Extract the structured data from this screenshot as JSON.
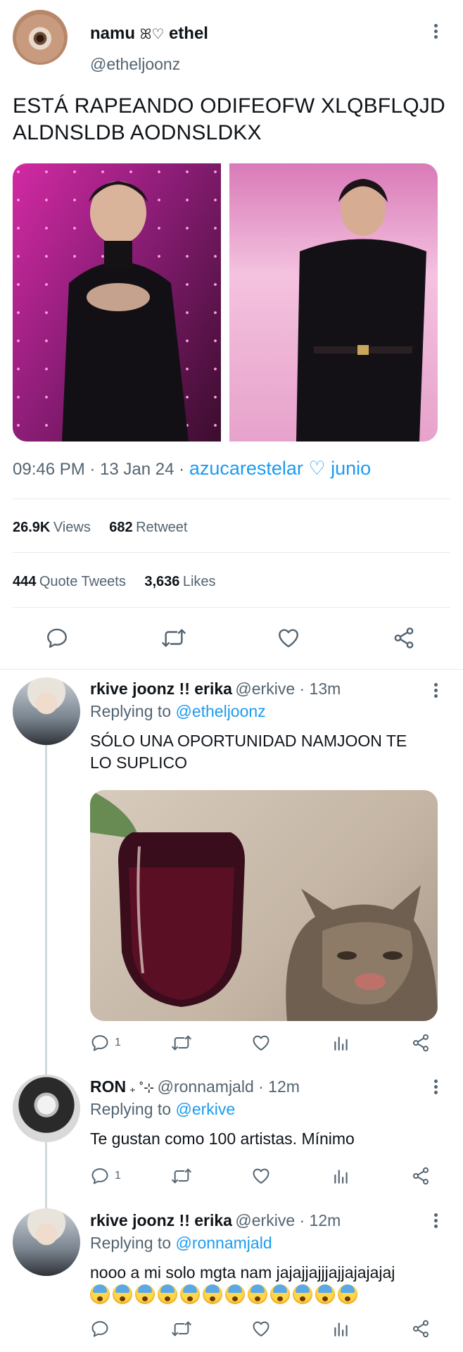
{
  "main_tweet": {
    "display_name": "namu",
    "display_name_suffix": "ethel",
    "handle": "@etheljoonz",
    "text_line1": "ESTÁ RAPEANDO ODIFEOFW XLQBFLQJD",
    "text_line2": "ALDNSLDB AODNSLDKX",
    "time": "09:46 PM · 13 Jan 24 ·",
    "source": "azucarestelar ♡ junio",
    "views_count": "26.9K",
    "views_label": "Views",
    "retweet_count": "682",
    "retweet_label": "Retweet",
    "quote_count": "444",
    "quote_label": "Quote Tweets",
    "likes_count": "3,636",
    "likes_label": "Likes"
  },
  "replies": [
    {
      "display_name": "rkive joonz !! erika",
      "handle_time": "@erkive · 13m",
      "replying_label": "Replying to",
      "replying_to": "@etheljoonz",
      "text_line1": "SÓLO UNA OPORTUNIDAD NAMJOON TE",
      "text_line2": "LO SUPLICO",
      "reply_count": "1"
    },
    {
      "display_name": "RON",
      "name_suffix": "₊ ˚⊹",
      "handle_time": "@ronnamjald · 12m",
      "replying_label": "Replying to",
      "replying_to": "@erkive",
      "text_line1": "Te gustan como 100 artistas. Mínimo",
      "reply_count": "1"
    },
    {
      "display_name": "rkive joonz !! erika",
      "handle_time": "@erkive · 12m",
      "replying_label": "Replying to",
      "replying_to": "@ronnamjald",
      "text_line1": "nooo a mi solo mgta nam jajajjajjjajjajajajaj",
      "emoji_count": 12
    }
  ],
  "icons": {
    "reply": "reply-icon",
    "retweet": "retweet-icon",
    "like": "heart-icon",
    "share": "share-icon",
    "analytics": "analytics-icon",
    "more": "more-dots-icon"
  },
  "colors": {
    "link": "#1d9bf0",
    "muted": "#536471",
    "divider": "#e6ecf0",
    "text": "#0f1419"
  }
}
